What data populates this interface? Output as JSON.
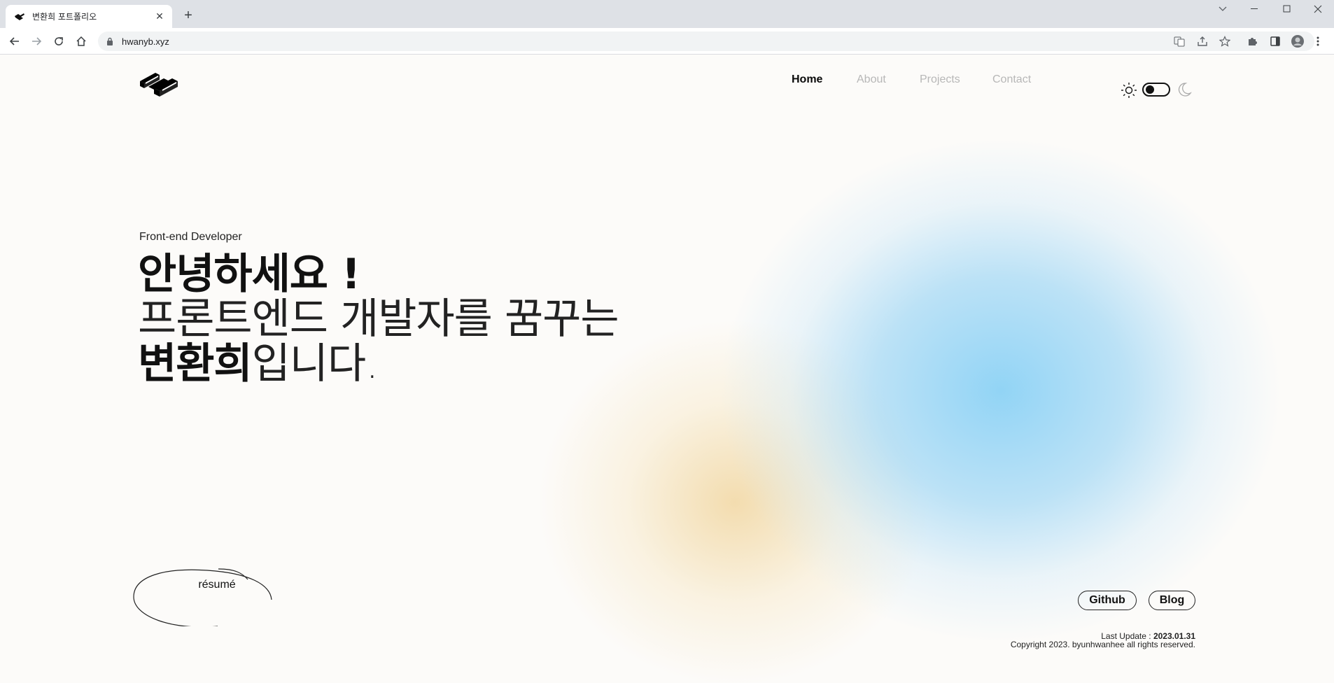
{
  "browser": {
    "tab_title": "변환희 포트폴리오",
    "url": "hwanyb.xyz"
  },
  "site": {
    "nav": [
      {
        "label": "Home",
        "active": true
      },
      {
        "label": "About",
        "active": false
      },
      {
        "label": "Projects",
        "active": false
      },
      {
        "label": "Contact",
        "active": false
      }
    ],
    "theme": {
      "mode": "light",
      "sun_icon": "sun-icon",
      "moon_icon": "moon-icon"
    },
    "hero": {
      "subtitle": "Front-end Developer",
      "greeting": "안녕하세요 !",
      "line2": "프론트엔드 개발자를 꿈꾸는",
      "name": "변환희",
      "line3_suffix": "입니다."
    },
    "resume_label": "résumé",
    "links": {
      "github": "Github",
      "blog": "Blog"
    },
    "footer": {
      "update_label": "Last Update : ",
      "update_date": "2023.01.31",
      "copyright": "Copyright 2023. byunhwanhee all rights reserved."
    },
    "colors": {
      "blob_blue": "#8dd3f5",
      "blob_yellow": "#f0d296",
      "background": "#fcfbf9",
      "text": "#111111",
      "nav_inactive": "#b7b7b7"
    }
  }
}
